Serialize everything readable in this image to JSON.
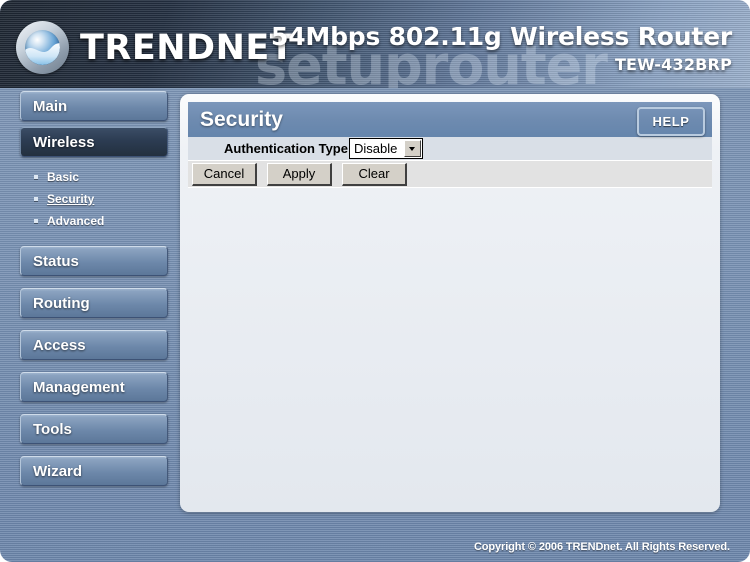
{
  "header": {
    "brand": "TRENDNET",
    "logo_icon": "trendnet-globe-logo",
    "product_title": "54Mbps 802.11g Wireless Router",
    "model_number": "TEW-432BRP",
    "watermark": "setuprouter"
  },
  "sidebar": {
    "items": [
      {
        "label": "Main",
        "active": false
      },
      {
        "label": "Wireless",
        "active": true
      },
      {
        "label": "Status",
        "active": false
      },
      {
        "label": "Routing",
        "active": false
      },
      {
        "label": "Access",
        "active": false
      },
      {
        "label": "Management",
        "active": false
      },
      {
        "label": "Tools",
        "active": false
      },
      {
        "label": "Wizard",
        "active": false
      }
    ],
    "sub_items": [
      {
        "label": "Basic",
        "current": false
      },
      {
        "label": "Security",
        "current": true
      },
      {
        "label": "Advanced",
        "current": false
      }
    ]
  },
  "panel": {
    "title": "Security",
    "help_label": "HELP",
    "form": {
      "auth_type_label": "Authentication Type",
      "auth_type_value": "Disable",
      "auth_type_options": [
        "Disable"
      ]
    },
    "buttons": {
      "cancel": "Cancel",
      "apply": "Apply",
      "clear": "Clear"
    }
  },
  "footer": {
    "copyright": "Copyright © 2006 TRENDnet. All Rights Reserved."
  },
  "colors": {
    "page_bg": "#7790b2",
    "header_dark": "#1e2733",
    "header_light": "#9db2ce",
    "panel_bg": "#e7ebf1",
    "title_bar": "#6e8bb0",
    "nav_button": "#6d88aa",
    "nav_button_active": "#2c3c52",
    "help_button": "#2f4e74",
    "win_face": "#d4d0c8"
  }
}
